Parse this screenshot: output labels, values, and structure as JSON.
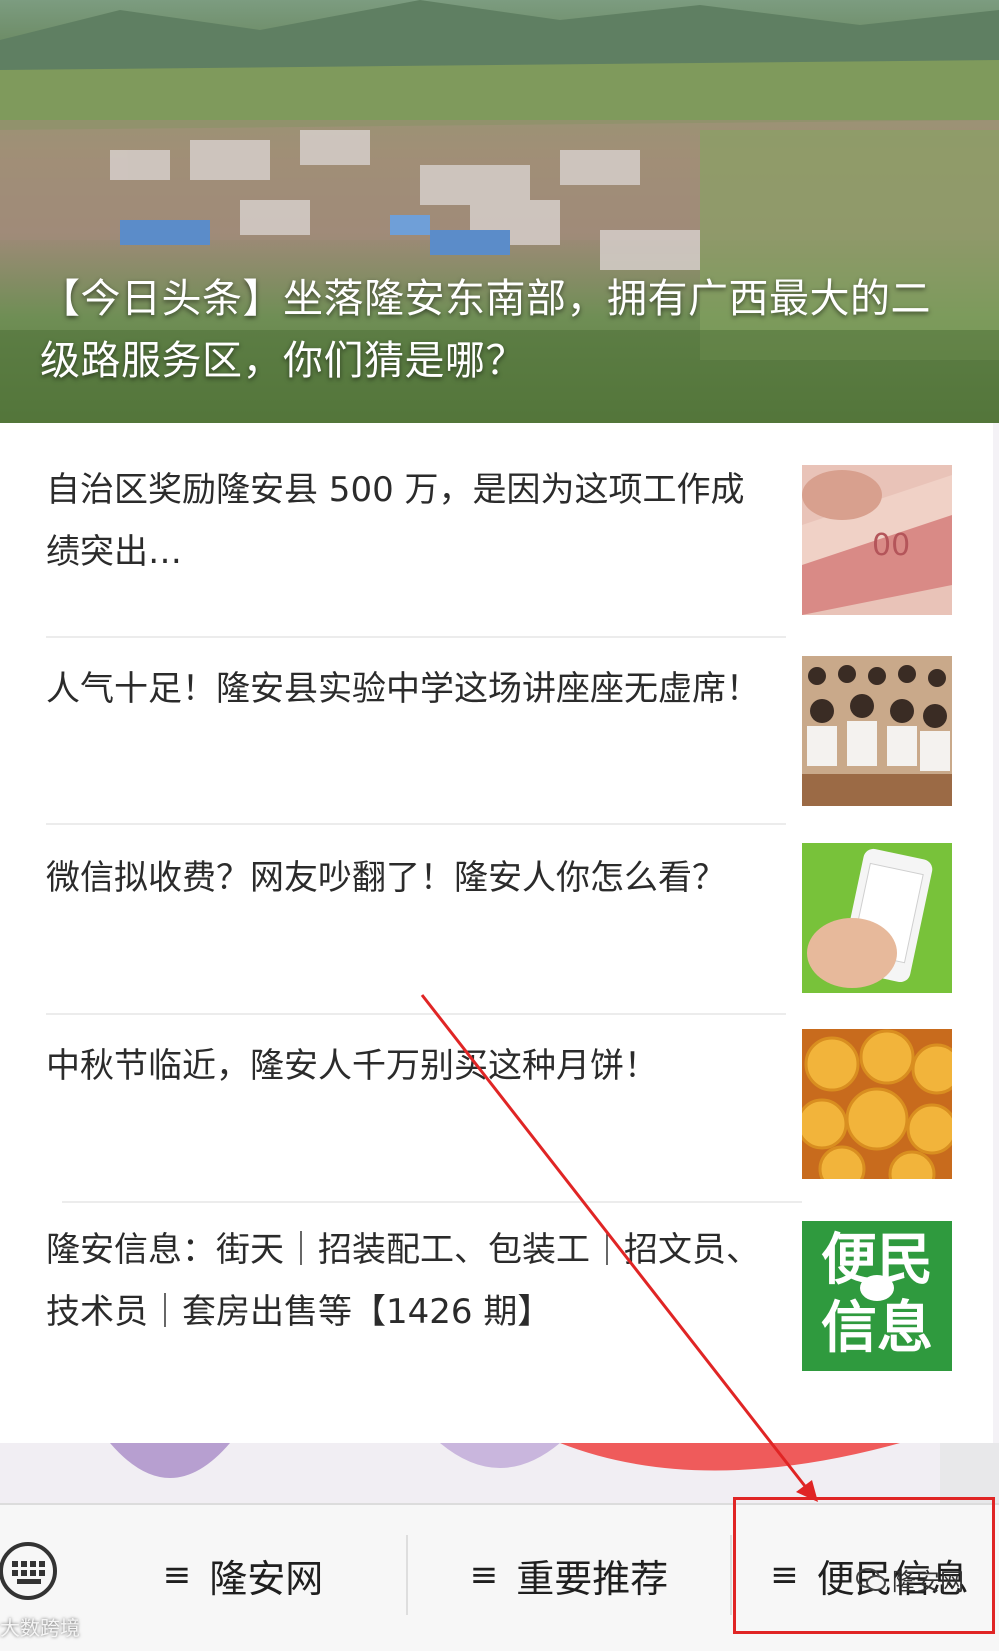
{
  "hero": {
    "title": "【今日头条】坐落隆安东南部，拥有广西最大的二级路服务区，你们猜是哪？"
  },
  "articles": [
    {
      "title": "自治区奖励隆安县 500 万，是因为这项工作成绩突出…",
      "thumb": "money-icon"
    },
    {
      "title": "人气十足！隆安县实验中学这场讲座座无虚席！",
      "thumb": "students-icon"
    },
    {
      "title": "微信拟收费？网友吵翻了！隆安人你怎么看？",
      "thumb": "phone-icon"
    },
    {
      "title": "中秋节临近，隆安人千万别买这种月饼！",
      "thumb": "mooncake-icon"
    },
    {
      "title": "隆安信息：街天｜招装配工、包装工｜招文员、技术员｜套房出售等【1426 期】",
      "thumb": "bianmin-logo"
    }
  ],
  "bianmin_logo": {
    "top": "便民",
    "bottom": "信息"
  },
  "menu": {
    "eq": "≡",
    "items": [
      "隆安网",
      "重要推荐",
      "便民信息"
    ]
  },
  "watermark": "大数跨境",
  "brand": "隆安网",
  "colors": {
    "highlight": "#e02525",
    "logo_green": "#2f9a3e"
  }
}
